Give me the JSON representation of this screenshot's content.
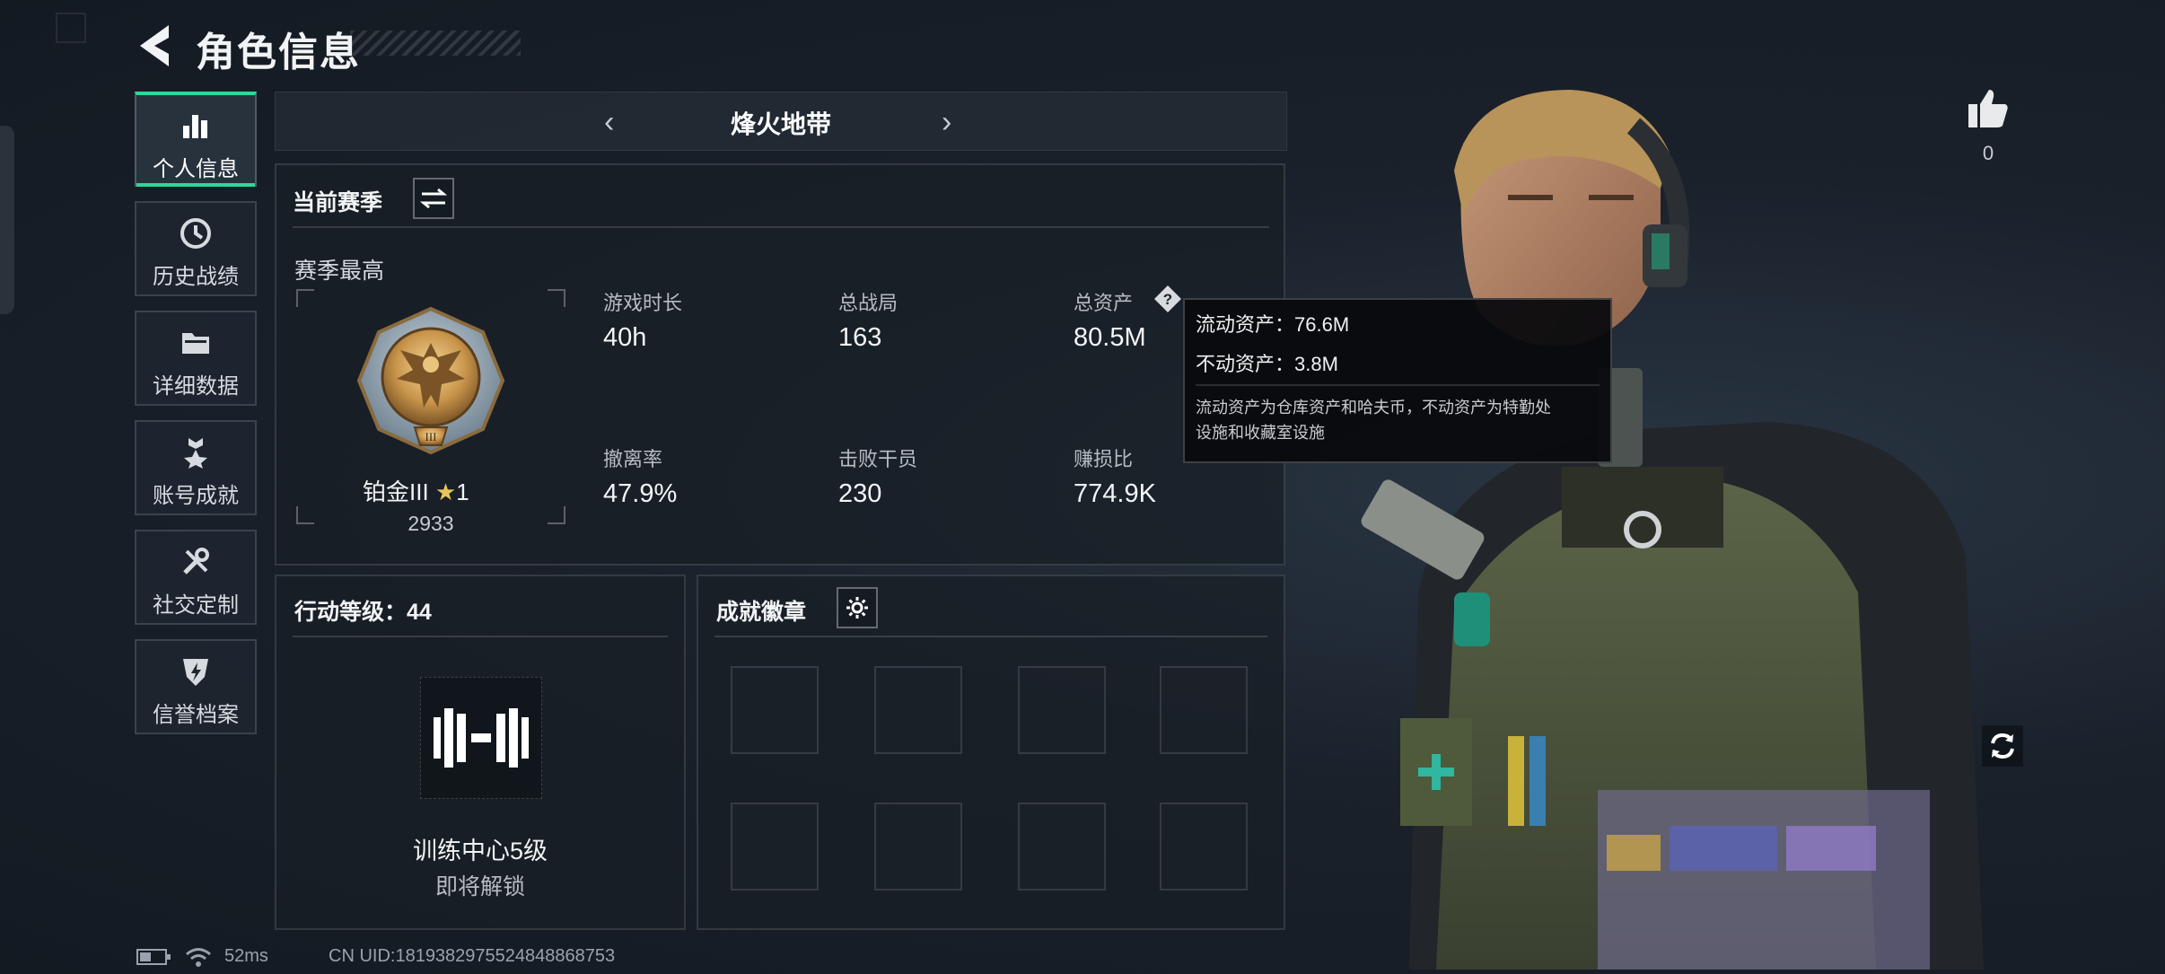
{
  "header": {
    "title": "角色信息"
  },
  "nav": [
    {
      "label": "个人信息",
      "icon": "bar-chart-icon",
      "active": true
    },
    {
      "label": "历史战绩",
      "icon": "history-clock-icon",
      "active": false
    },
    {
      "label": "详细数据",
      "icon": "folder-icon",
      "active": false
    },
    {
      "label": "账号成就",
      "icon": "achievement-star-icon",
      "active": false
    },
    {
      "label": "社交定制",
      "icon": "tools-icon",
      "active": false
    },
    {
      "label": "信誉档案",
      "icon": "reputation-shield-icon",
      "active": false
    }
  ],
  "mode": {
    "name": "烽火地带"
  },
  "season": {
    "title": "当前赛季",
    "best_label": "赛季最高",
    "rank_name": "铂金III",
    "rank_stars": "1",
    "rank_score": "2933",
    "stats": [
      {
        "label": "游戏时长",
        "value": "40h"
      },
      {
        "label": "总战局",
        "value": "163"
      },
      {
        "label": "总资产",
        "value": "80.5M"
      },
      {
        "label": "撤离率",
        "value": "47.9%"
      },
      {
        "label": "击败干员",
        "value": "230"
      },
      {
        "label": "赚损比",
        "value": "774.9K"
      }
    ]
  },
  "tooltip": {
    "liquid": "流动资产：76.6M",
    "fixed": "不动资产：3.8M",
    "note_line1": "流动资产为仓库资产和哈夫币，不动资产为特勤处",
    "note_line2": "设施和收藏室设施"
  },
  "action_level": {
    "title": "行动等级：44",
    "unlock_name": "训练中心5级",
    "unlock_status": "即将解锁"
  },
  "badges": {
    "title": "成就徽章",
    "slot_count": 8
  },
  "likes": {
    "count": "0"
  },
  "status_bar": {
    "ping": "52ms",
    "uid": "CN UID:1819382975524848868753"
  },
  "colors": {
    "accent": "#2fd79a",
    "panel": "#182026",
    "background": "#1a212b"
  }
}
